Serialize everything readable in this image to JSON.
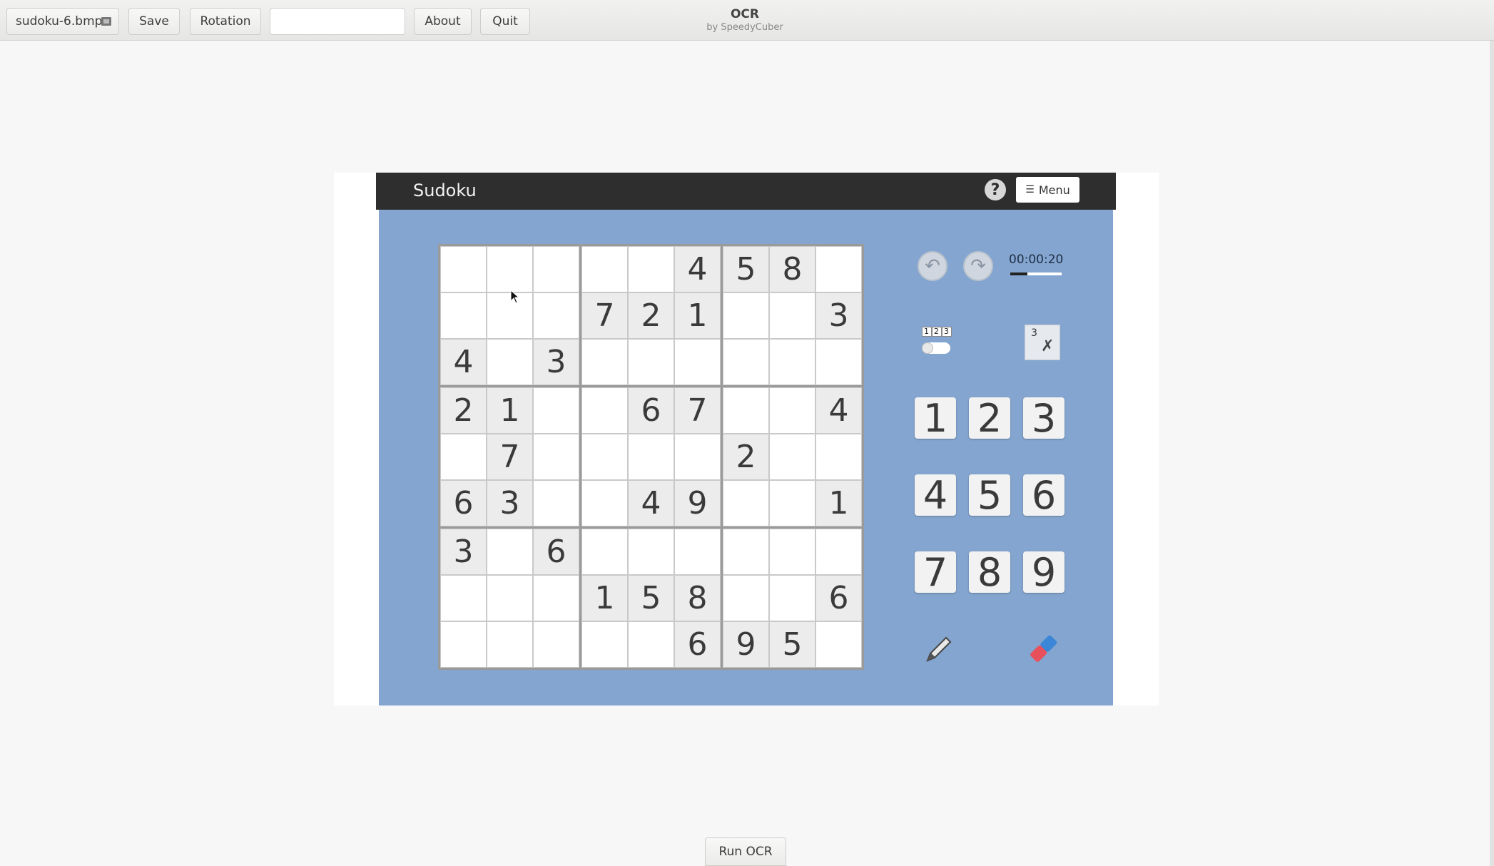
{
  "toolbar": {
    "file_label": "sudoku-6.bmp",
    "save_label": "Save",
    "rotation_label": "Rotation",
    "entry_value": "",
    "about_label": "About",
    "quit_label": "Quit",
    "app_title": "OCR",
    "app_subtitle": "by SpeedyCuber"
  },
  "sudoku": {
    "title": "Sudoku",
    "help_label": "?",
    "menu_label": "Menu",
    "timer": "00:00:20",
    "timer_progress": 0.33,
    "toggle_numbers": [
      "1",
      "2",
      "3"
    ],
    "autonote_number": "3",
    "board": [
      [
        "",
        "",
        "",
        "",
        "",
        "4",
        "5",
        "8",
        ""
      ],
      [
        "",
        "",
        "",
        "7",
        "2",
        "1",
        "",
        "",
        "3"
      ],
      [
        "4",
        "",
        "3",
        "",
        "",
        "",
        "",
        "",
        ""
      ],
      [
        "2",
        "1",
        "",
        "",
        "6",
        "7",
        "",
        "",
        "4"
      ],
      [
        "",
        "7",
        "",
        "",
        "",
        "",
        "2",
        "",
        ""
      ],
      [
        "6",
        "3",
        "",
        "",
        "4",
        "9",
        "",
        "",
        "1"
      ],
      [
        "3",
        "",
        "6",
        "",
        "",
        "",
        "",
        "",
        ""
      ],
      [
        "",
        "",
        "",
        "1",
        "5",
        "8",
        "",
        "",
        "6"
      ],
      [
        "",
        "",
        "",
        "",
        "",
        "6",
        "9",
        "5",
        ""
      ]
    ],
    "keypad": [
      "1",
      "2",
      "3",
      "4",
      "5",
      "6",
      "7",
      "8",
      "9"
    ]
  },
  "bottom": {
    "run_label": "Run OCR"
  },
  "colors": {
    "board_bg": "#84a5cf",
    "header_bg": "#2e2e2e",
    "given_cell": "#ececec",
    "empty_cell": "#ffffff"
  }
}
